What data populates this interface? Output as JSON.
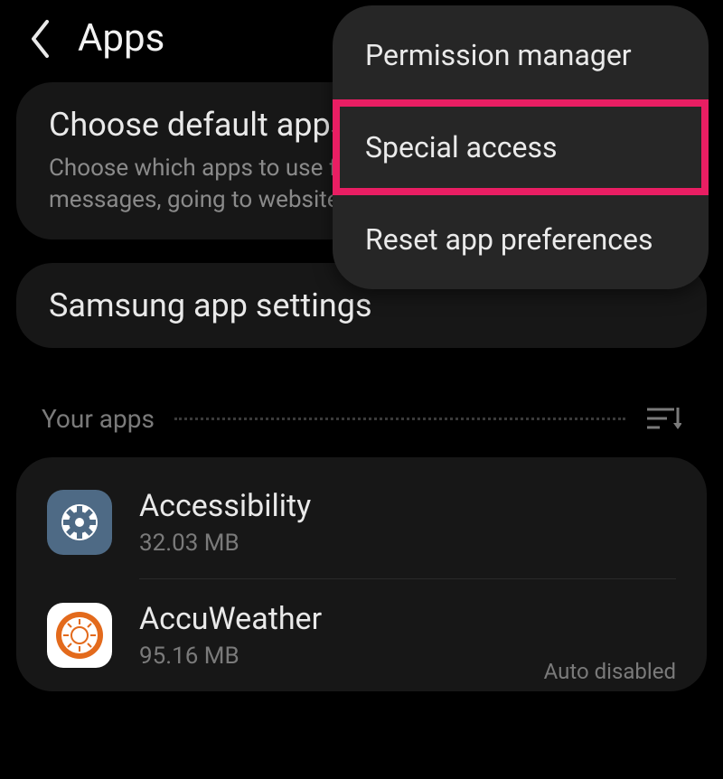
{
  "header": {
    "title": "Apps"
  },
  "defaultApps": {
    "title": "Choose default apps",
    "subtitle": "Choose which apps to use for making calls, sending messages, going to websites, and more."
  },
  "samsung": {
    "title": "Samsung app settings"
  },
  "section": {
    "label": "Your apps"
  },
  "apps": [
    {
      "name": "Accessibility",
      "size": "32.03 MB",
      "badge": ""
    },
    {
      "name": "AccuWeather",
      "size": "95.16 MB",
      "badge": "Auto disabled"
    }
  ],
  "menu": {
    "items": [
      "Permission manager",
      "Special access",
      "Reset app preferences"
    ]
  },
  "colors": {
    "highlight": "#e91e63",
    "cardBg": "#171717",
    "menuBg": "#262626",
    "gearIconBg": "#4e6a85",
    "accuIconAccent": "#e36a1c"
  }
}
